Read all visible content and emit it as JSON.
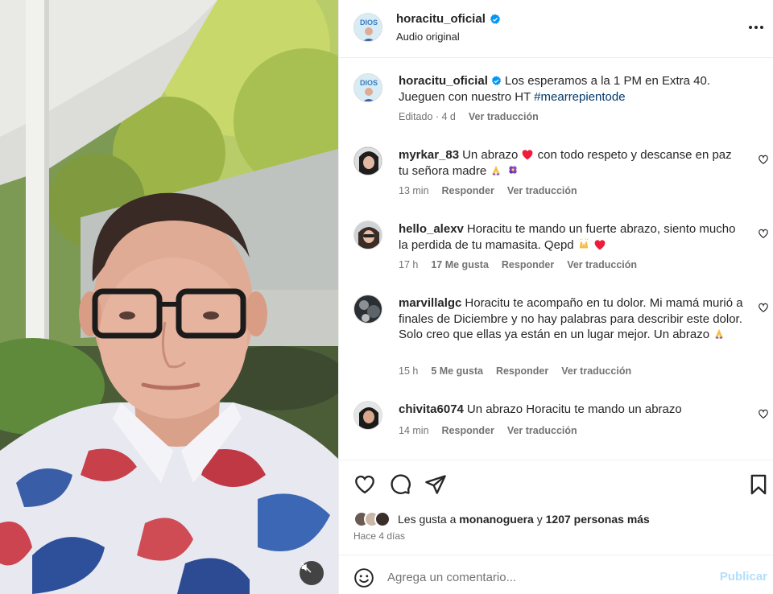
{
  "post": {
    "author": "horacitu_oficial",
    "audio_label": "Audio original",
    "caption_author": "horacitu_oficial",
    "caption_text": "Los esperamos a la 1 PM en Extra 40. Jueguen con nuestro HT",
    "caption_hashtag": "#mearrepientode",
    "caption_edited": "Editado · 4 d",
    "caption_translate": "Ver traducción",
    "avatar_text": "DIOS"
  },
  "comments": [
    {
      "user": "myrkar_83",
      "text_before": "Un abrazo",
      "text_after": "con todo respeto y descanse en paz tu señora madre",
      "time": "13 min",
      "likes": "",
      "reply": "Responder",
      "translate": "Ver traducción"
    },
    {
      "user": "hello_alexv",
      "text_before": "Horacitu te mando un fuerte abrazo, siento mucho la perdida de tu mamasita. Qepd",
      "time": "17 h",
      "likes": "17 Me gusta",
      "reply": "Responder",
      "translate": "Ver traducción"
    },
    {
      "user": "marvillalgc",
      "text_before": "Horacitu te acompaño en tu dolor. Mi mamá murió a finales de Diciembre y no hay palabras para describir este dolor. Solo creo que ellas ya están en un lugar mejor. Un abrazo",
      "time": "15 h",
      "likes": "5 Me gusta",
      "reply": "Responder",
      "translate": "Ver traducción"
    },
    {
      "user": "chivita6074",
      "text_before": "Un abrazo Horacitu te mando un abrazo",
      "time": "14 min",
      "likes": "",
      "reply": "Responder",
      "translate": "Ver traducción"
    }
  ],
  "likes": {
    "prefix": "Les gusta a",
    "user": "monanoguera",
    "connector": "y",
    "others": "1207 personas más",
    "date": "Hace 4 días"
  },
  "add_comment": {
    "placeholder": "Agrega un comentario...",
    "post_label": "Publicar"
  },
  "icons": {
    "more": "more-horizontal-icon",
    "verified": "verified-badge-icon",
    "like": "heart-icon",
    "comment": "comment-icon",
    "share": "send-icon",
    "save": "bookmark-icon",
    "emoji": "smiley-icon",
    "mute": "speaker-muted-icon"
  },
  "colors": {
    "verified": "#0095f6",
    "hashtag": "#00376b",
    "secondary_text": "#737373",
    "heart": "#ed1c3a",
    "post_disabled": "#b2dffc"
  }
}
